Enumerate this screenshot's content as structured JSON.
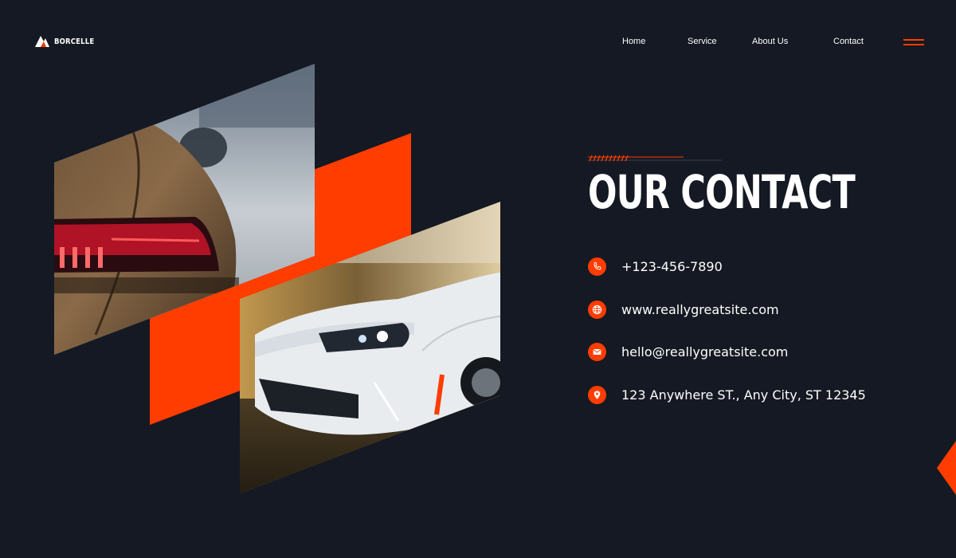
{
  "brand": {
    "name": "BORCELLE",
    "logo_icon": "triangle-logo-icon"
  },
  "nav": {
    "items": [
      {
        "label": "Home"
      },
      {
        "label": "Service"
      },
      {
        "label": "About Us"
      },
      {
        "label": "Contact"
      }
    ],
    "menu_icon": "hamburger-menu-icon"
  },
  "hero": {
    "title": "OUR CONTACT",
    "images": [
      {
        "subject": "car-taillight-photo"
      },
      {
        "subject": "white-sports-car-photo"
      }
    ]
  },
  "contacts": [
    {
      "icon": "phone-icon",
      "text": "+123-456-7890"
    },
    {
      "icon": "globe-icon",
      "text": "www.reallygreatsite.com"
    },
    {
      "icon": "mail-icon",
      "text": "hello@reallygreatsite.com"
    },
    {
      "icon": "location-pin-icon",
      "text": "123 Anywhere ST., Any City, ST 12345"
    }
  ],
  "colors": {
    "background": "#151923",
    "accent": "#ff3d00",
    "text": "#ffffff"
  }
}
